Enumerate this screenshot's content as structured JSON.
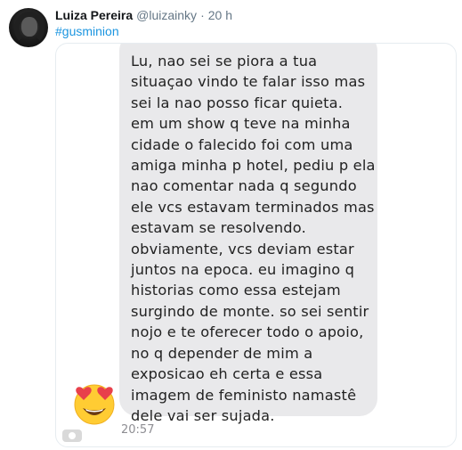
{
  "tweet": {
    "author_name": "Luiza Pereira",
    "handle": "@luizainky",
    "separator": "·",
    "time": "20 h",
    "hashtag": "#gusminion"
  },
  "screenshot": {
    "message_text": "Lu, nao sei se piora a tua\nsituaçao vindo te falar isso mas\nsei la nao posso ficar quieta.\nem um show q teve na minha\ncidade o falecido foi com uma\namiga minha p hotel, pediu p ela\nnao comentar nada q segundo\nele vcs estavam terminados mas\nestavam se resolvendo.\nobviamente, vcs deviam estar\njuntos na epoca. eu imagino q\nhistorias como essa estejam\nsurgindo de monte. so sei sentir\nnojo e te oferecer todo o apoio,\nno q depender de mim a\nexposicao eh certa e essa\nimagem de feministo namastê\ndele vai ser sujada.",
    "message_time": "20:57",
    "bubble_color": "#e9e9eb",
    "reaction_icon": "heart-eyes-emoji-icon"
  },
  "colors": {
    "link": "#1b95e0",
    "secondary_text": "#657786"
  }
}
